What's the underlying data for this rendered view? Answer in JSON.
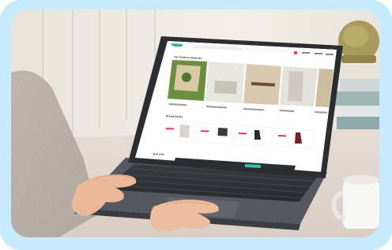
{
  "scene": {
    "frame_color": "#c6ebfb",
    "wall_color": "#f1ece6",
    "laptop_body_color": "#2b2d31",
    "screen_bg": "#ffffff",
    "accent_color": "#2ec4a6",
    "badge_color": "#e8394b"
  },
  "screen": {
    "brand": "flipkart",
    "section_top_title": "Top Trending Categories",
    "section_guides_title": "Buying Guides",
    "section_bottom_title": "Best seller"
  },
  "icons": [
    "plant-pot",
    "book-stack",
    "mug",
    "laptop"
  ]
}
